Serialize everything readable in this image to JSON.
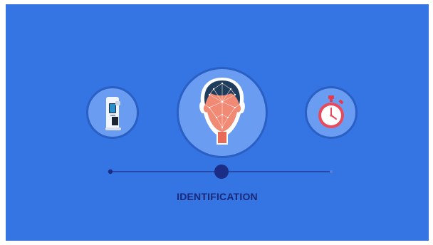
{
  "stage": {
    "step_label": "IDENTIFICATION",
    "colors": {
      "background": "#3574e3",
      "circle_fill": "#6a9cf2",
      "circle_border": "#2a5fc4",
      "label": "#1a2878",
      "track_line": "#203a9a",
      "active_dot": "#1b2d85"
    }
  },
  "icons": {
    "left": "kiosk-terminal-icon",
    "center": "face-scan-icon",
    "right": "stopwatch-icon"
  },
  "progress": {
    "current_step_fraction": 0.5
  }
}
